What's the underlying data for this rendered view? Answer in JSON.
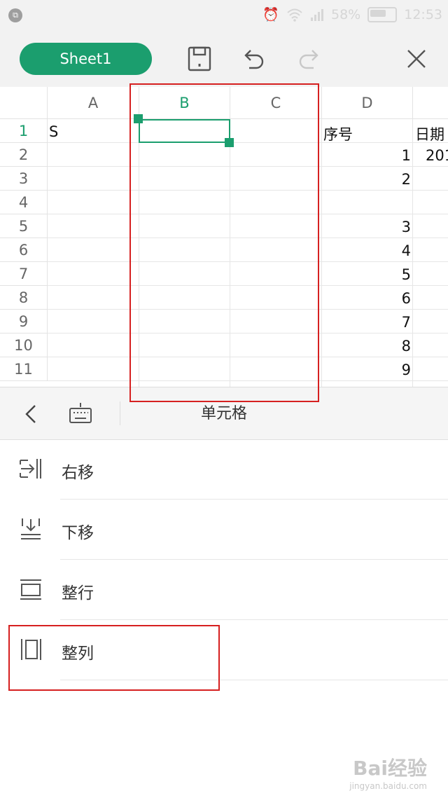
{
  "status_bar": {
    "battery_percent": "58%",
    "time": "12:53"
  },
  "toolbar": {
    "sheet_tab": "Sheet1"
  },
  "grid": {
    "columns": [
      "A",
      "B",
      "C",
      "D"
    ],
    "rows": [
      "1",
      "2",
      "3",
      "4",
      "5",
      "6",
      "7",
      "8",
      "9",
      "10",
      "11"
    ],
    "cells": {
      "A1": "S",
      "D1": "序号",
      "E1": "日期",
      "E2": "201",
      "D2": "1",
      "D3": "2",
      "D5": "3",
      "D6": "4",
      "D7": "5",
      "D8": "6",
      "D9": "7",
      "D10": "8",
      "D11": "9"
    },
    "selected_cell": "B1"
  },
  "panel": {
    "title": "单元格",
    "items": [
      {
        "label": "右移",
        "icon": "shift-right-icon"
      },
      {
        "label": "下移",
        "icon": "shift-down-icon"
      },
      {
        "label": "整行",
        "icon": "entire-row-icon"
      },
      {
        "label": "整列",
        "icon": "entire-column-icon"
      }
    ]
  },
  "colors": {
    "accent": "#1b9e6e",
    "highlight": "#d62020"
  },
  "watermark": {
    "brand": "Bai经验",
    "url": "jingyan.baidu.com"
  }
}
